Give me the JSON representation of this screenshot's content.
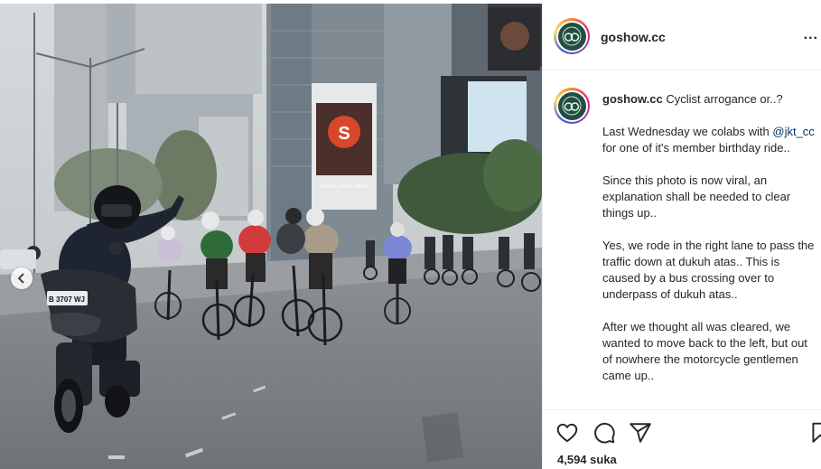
{
  "header": {
    "username": "goshow.cc",
    "more_label": "..."
  },
  "post": {
    "caption_user": "goshow.cc",
    "caption_title": "Cyclist arrogance or..?",
    "paragraph1_before": "Last Wednesday we colabs with",
    "mention": "@jkt_cc",
    "paragraph1_after": "for one of it's member birthday ride..",
    "paragraph2": "Since this photo is now viral, an explanation shall be needed to clear things up..",
    "paragraph3": "Yes, we rode in the right lane to pass the traffic down at dukuh atas.. This is caused by a bus crossing over to underpass of dukuh atas..",
    "paragraph4": "After we thought all was cleared, we wanted to move back to the left, but out of nowhere the motorcycle gentlemen came up.."
  },
  "photo": {
    "billboard_text": "S",
    "billboard_small": "SPACE AVAILABLE",
    "plate_text": "B 3707 WJ"
  },
  "actions": {
    "likes_label": "4,594 suka",
    "icons": [
      "heart-icon",
      "comment-icon",
      "share-icon",
      "save-icon"
    ]
  },
  "colors": {
    "avatar_bg": "#1f4e46",
    "mention": "#00376b",
    "text": "#262626"
  }
}
